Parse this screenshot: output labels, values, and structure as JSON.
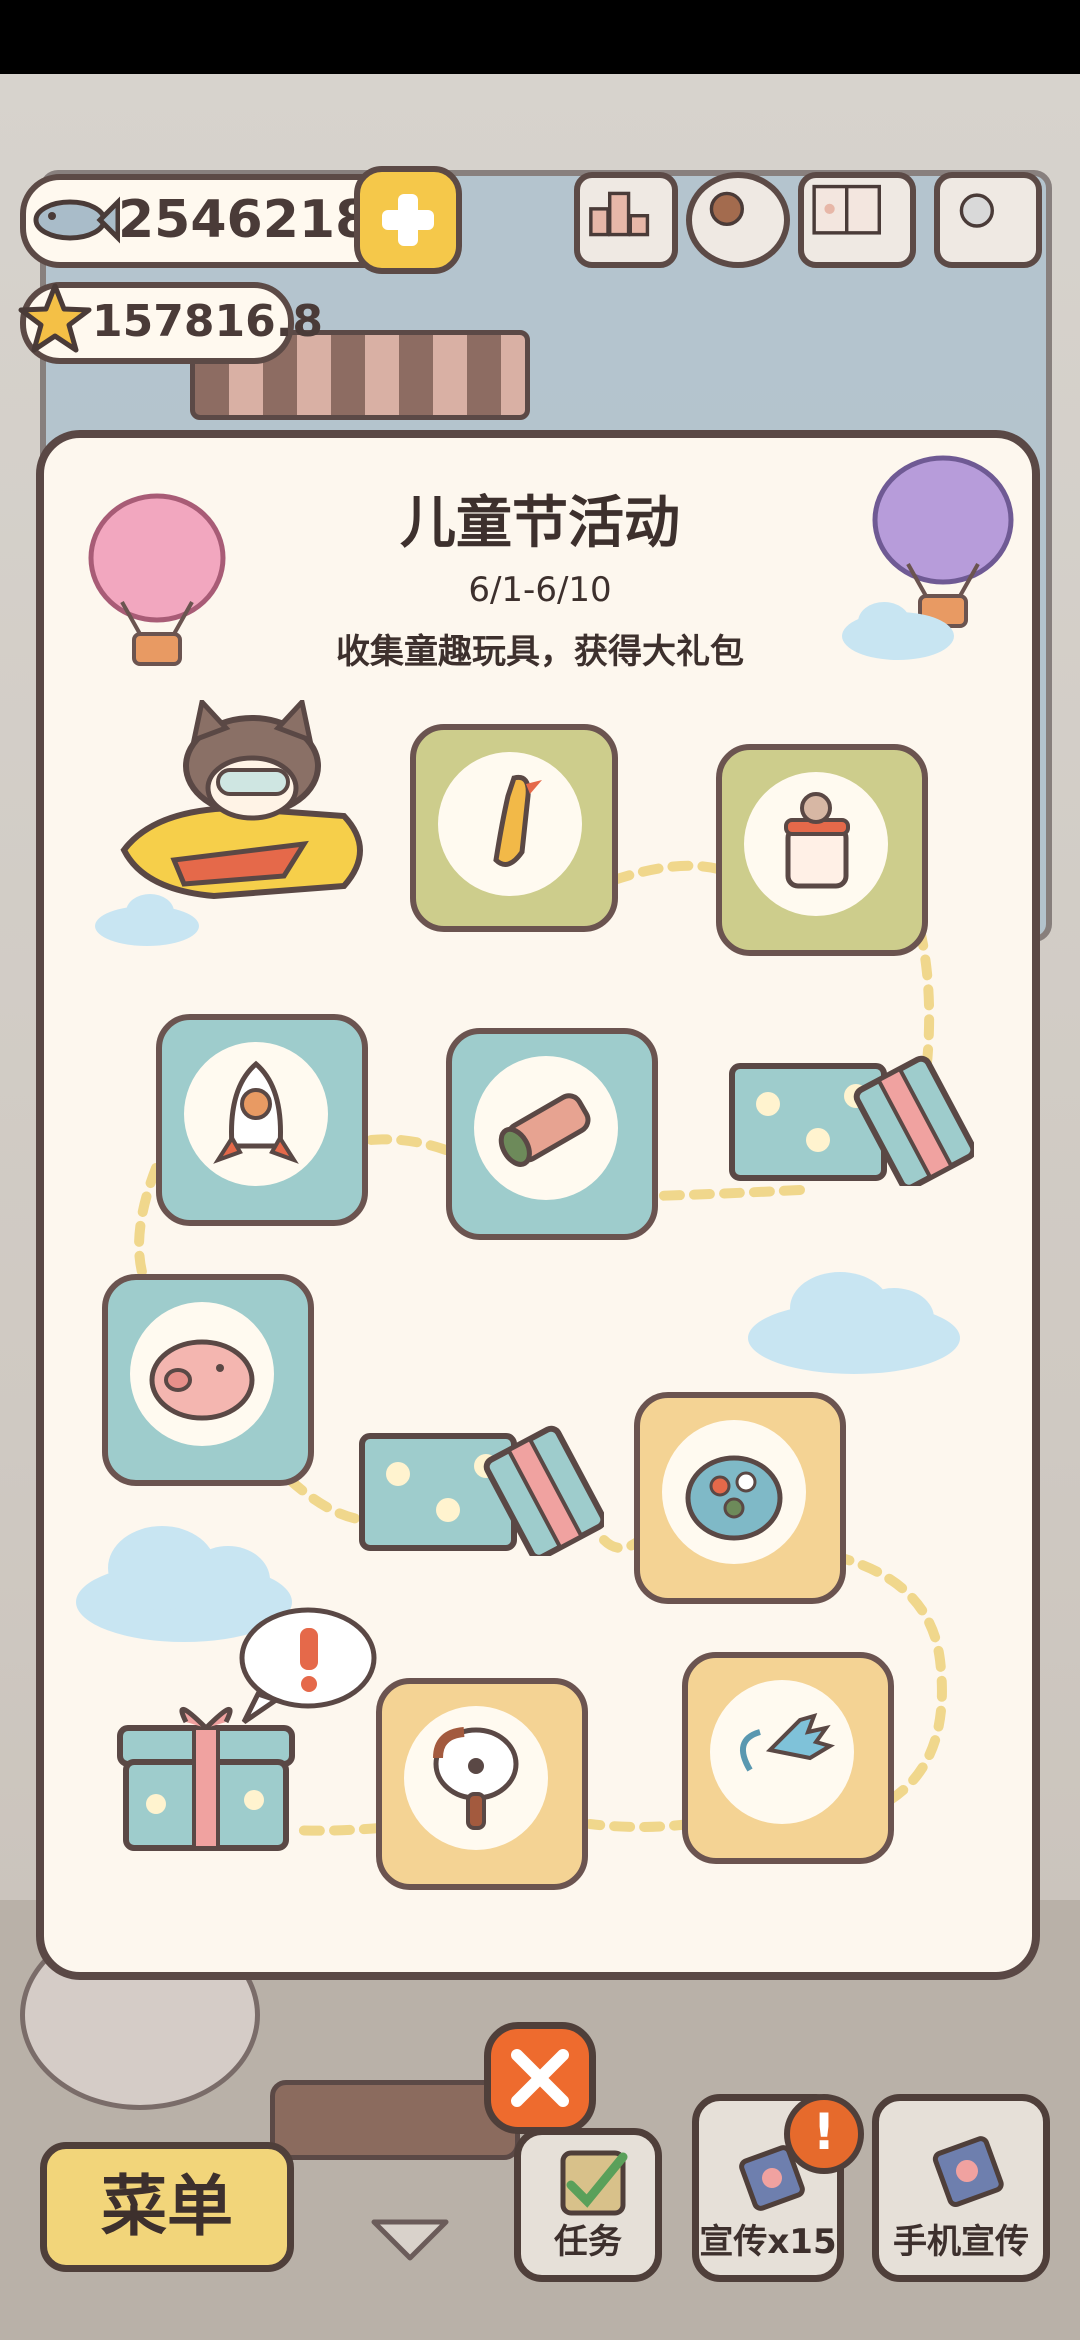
{
  "currency": {
    "fish": "25462182",
    "stars": "157816.8"
  },
  "event": {
    "title": "儿童节活动",
    "date": "6/1-6/10",
    "description": "收集童趣玩具，获得大礼包"
  },
  "items": [
    {
      "name": "rubber-chicken-toy",
      "color": "olive"
    },
    {
      "name": "baby-bottle-toy",
      "color": "olive"
    },
    {
      "name": "rocket-toy",
      "color": "teal"
    },
    {
      "name": "kaleidoscope-toy",
      "color": "teal"
    },
    {
      "name": "piggy-bank-toy",
      "color": "teal"
    },
    {
      "name": "marble-tin-toy",
      "color": "yellow"
    },
    {
      "name": "paw-fan-toy",
      "color": "yellow"
    },
    {
      "name": "sticky-hand-toy",
      "color": "yellow"
    }
  ],
  "bottom_bar": {
    "menu": "菜单",
    "tasks": "任务",
    "promote": "宣传x15",
    "phone_promote": "手机宣传",
    "promote_alert": "!"
  },
  "colors": {
    "panel": "#fdf7ee",
    "olive_tile": "#cdcd8c",
    "teal_tile": "#9ecccc",
    "yellow_tile": "#f4d394",
    "close": "#ee6b2e",
    "menu": "#f2d57a"
  }
}
